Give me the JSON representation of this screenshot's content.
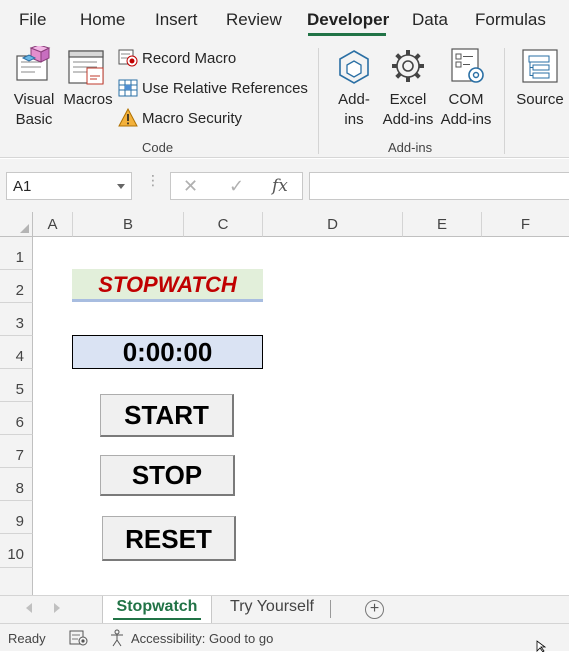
{
  "menu": {
    "tabs": [
      {
        "label": "File"
      },
      {
        "label": "Home"
      },
      {
        "label": "Insert"
      },
      {
        "label": "Review"
      },
      {
        "label": "Developer",
        "active": true
      },
      {
        "label": "Data"
      },
      {
        "label": "Formulas"
      }
    ]
  },
  "ribbon": {
    "code": {
      "visual_basic": [
        "Visual",
        "Basic"
      ],
      "macros": "Macros",
      "record_macro": "Record Macro",
      "use_relative": "Use Relative References",
      "macro_security": "Macro Security",
      "group_label": "Code"
    },
    "addins": {
      "addins": [
        "Add-",
        "ins"
      ],
      "excel_addins": [
        "Excel",
        "Add-ins"
      ],
      "com_addins": [
        "COM",
        "Add-ins"
      ],
      "group_label": "Add-ins"
    },
    "xml": {
      "source": "Source"
    }
  },
  "formula_bar": {
    "name_box": "A1",
    "cancel_glyph": "✕",
    "enter_glyph": "✓",
    "fx_glyph": "fx",
    "formula": ""
  },
  "grid": {
    "columns": [
      "A",
      "B",
      "C",
      "D",
      "E",
      "F"
    ],
    "rows": [
      "1",
      "2",
      "3",
      "4",
      "5",
      "6",
      "7",
      "8",
      "9",
      "10"
    ],
    "title": "STOPWATCH",
    "timer": "0:00:00",
    "buttons": {
      "start": "START",
      "stop": "STOP",
      "reset": "RESET"
    }
  },
  "sheets": {
    "tabs": [
      {
        "label": "Stopwatch",
        "active": true
      },
      {
        "label": "Try Yourself"
      }
    ],
    "add_glyph": "+"
  },
  "status": {
    "ready": "Ready",
    "accessibility": "Accessibility: Good to go"
  },
  "colors": {
    "accent": "#217346",
    "title_fill": "#e2efda",
    "title_text": "#c00000",
    "timer_fill": "#dae3f3"
  }
}
